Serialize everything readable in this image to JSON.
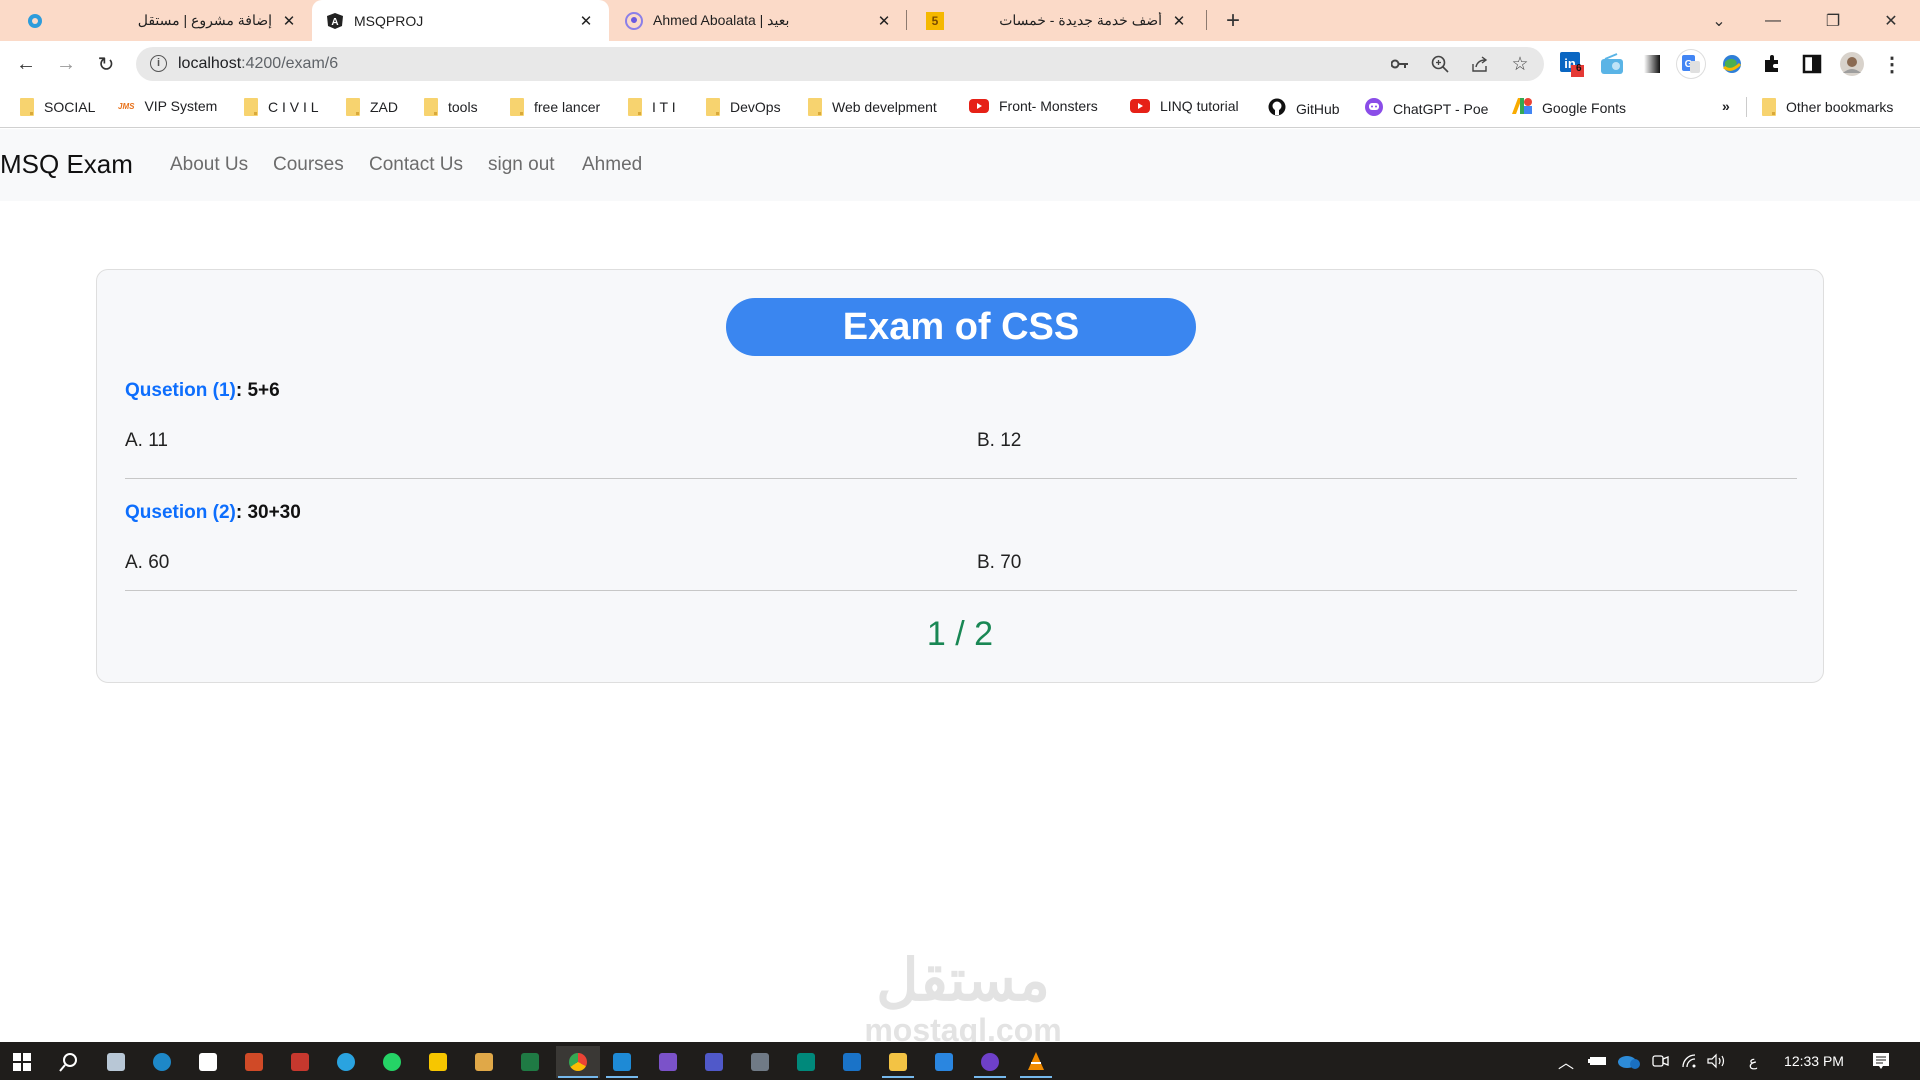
{
  "browser": {
    "tabs": [
      {
        "title": "إضافة مشروع | مستقل",
        "icon": "mostaql-icon",
        "active": false
      },
      {
        "title": "MSQPROJ",
        "icon": "angular-icon",
        "active": true
      },
      {
        "title": "Ahmed Aboalata | بعيد",
        "icon": "baeed-icon",
        "active": false
      },
      {
        "title": "أضف خدمة جديدة - خمسات",
        "icon": "khamsat-icon",
        "active": false
      }
    ],
    "new_tab_label": "+",
    "close_glyph": "✕",
    "khamsat_badge": "5",
    "window_controls": {
      "tab_search": "⌄",
      "minimize": "—",
      "restore": "❐",
      "close": "✕"
    },
    "url_host": "localhost",
    "url_path": ":4200/exam/6",
    "extensions": [
      {
        "name": "linkedin-extension",
        "badge": "6"
      },
      {
        "name": "radio-extension"
      },
      {
        "name": "gradient-extension"
      },
      {
        "name": "google-translate-extension"
      },
      {
        "name": "globe-extension"
      },
      {
        "name": "extensions-puzzle"
      },
      {
        "name": "side-panel"
      },
      {
        "name": "profile-avatar"
      },
      {
        "name": "menu-kebab"
      }
    ],
    "bookmarks": [
      {
        "label": "SOCIAL",
        "icon": "folder-icon"
      },
      {
        "label": "VIP System",
        "icon": "jms-icon"
      },
      {
        "label": "C I V I L",
        "icon": "folder-icon"
      },
      {
        "label": "ZAD",
        "icon": "folder-icon"
      },
      {
        "label": "tools",
        "icon": "folder-icon"
      },
      {
        "label": "free lancer",
        "icon": "folder-icon"
      },
      {
        "label": "I T I",
        "icon": "folder-icon"
      },
      {
        "label": "DevOps",
        "icon": "folder-icon"
      },
      {
        "label": "Web develpment",
        "icon": "folder-icon"
      },
      {
        "label": "Front- Monsters",
        "icon": "youtube-icon"
      },
      {
        "label": "LINQ tutorial",
        "icon": "youtube-icon"
      },
      {
        "label": "GitHub",
        "icon": "github-icon"
      },
      {
        "label": "ChatGPT - Poe",
        "icon": "poe-icon"
      },
      {
        "label": "Google Fonts",
        "icon": "google-fonts-icon"
      }
    ],
    "bookmarks_overflow": "»",
    "other_bookmarks": "Other bookmarks"
  },
  "app": {
    "brand": "MSQ Exam",
    "nav": [
      "About Us",
      "Courses",
      "Contact Us",
      "sign out",
      "Ahmed"
    ],
    "exam": {
      "title": "Exam of CSS",
      "questions": [
        {
          "label": "Qusetion (1)",
          "text": ": 5+6",
          "answers": [
            "A. 11",
            "B. 12"
          ]
        },
        {
          "label": "Qusetion (2)",
          "text": ": 30+30",
          "answers": [
            "A. 60",
            "B. 70"
          ]
        }
      ],
      "pager": "1 / 2"
    },
    "colors": {
      "title_bg": "#3a86f0",
      "question_label": "#0d6efd",
      "pager": "#198754"
    }
  },
  "watermark": {
    "arabic": "مستقل",
    "latin": "mostaql.com"
  },
  "taskbar": {
    "apps": [
      "start",
      "search",
      "presentation",
      "edge",
      "store",
      "powerpoint",
      "pdf-reader",
      "telegram",
      "whatsapp",
      "sticky-notes",
      "snipping-tool",
      "excel",
      "chrome",
      "vscode",
      "visual-studio",
      "teams",
      "calculator",
      "google-meet",
      "outlook",
      "file-explorer",
      "remote-desktop",
      "github-desktop",
      "vlc"
    ],
    "lang": "ع",
    "time": "12:33 PM"
  }
}
